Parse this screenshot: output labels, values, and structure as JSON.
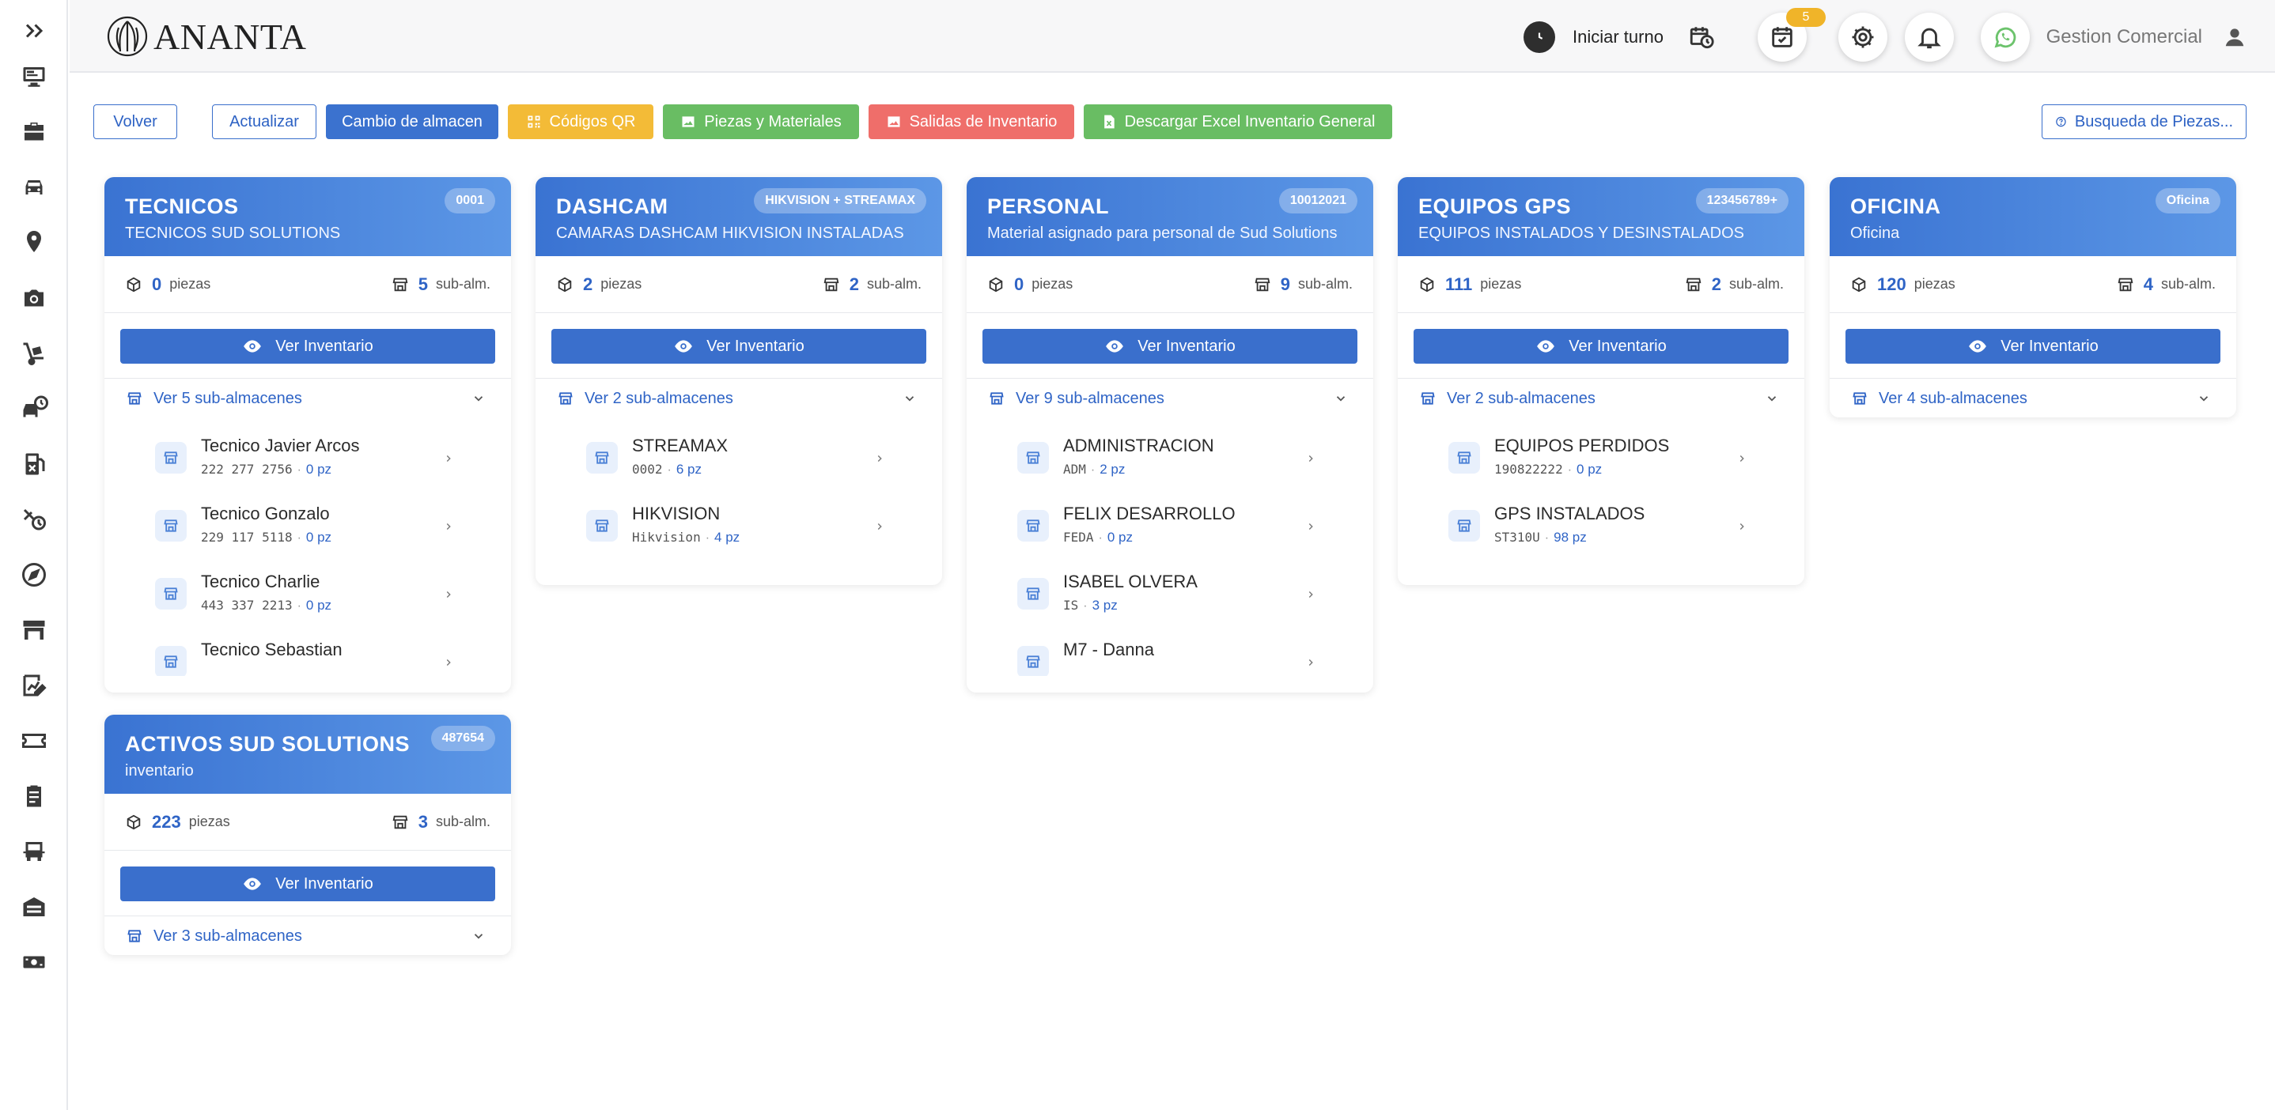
{
  "brand": {
    "name": "ANANTA"
  },
  "header": {
    "turno_label": "Iniciar turno",
    "tasks_badge": "5",
    "user_name": "Gestion Comercial"
  },
  "toolbar": {
    "volver": "Volver",
    "actualizar": "Actualizar",
    "cambio": "Cambio de almacen",
    "qr": "Códigos QR",
    "piezas": "Piezas y Materiales",
    "salidas": "Salidas de Inventario",
    "excel": "Descargar Excel Inventario General",
    "busqueda": "Busqueda de Piezas..."
  },
  "labels": {
    "piezas": "piezas",
    "subalm": "sub-alm.",
    "ver_inventario": "Ver Inventario",
    "dot": "·"
  },
  "colors": {
    "primary": "#3a6fcc",
    "header_gradient_start": "#3a73d2",
    "header_gradient_end": "#5c97e6",
    "yellow": "#f3bb37",
    "green": "#69bd63",
    "red": "#ef6e6a"
  },
  "warehouses": [
    {
      "title": "TECNICOS",
      "subtitle": "TECNICOS SUD SOLUTIONS",
      "code": "0001",
      "piezas": "0",
      "subalm": "5",
      "toggle": "Ver 5 sub-almacenes",
      "subs": [
        {
          "name": "Tecnico Javier Arcos",
          "code": "222 277 2756",
          "pz": "0 pz"
        },
        {
          "name": "Tecnico Gonzalo",
          "code": "229 117 5118",
          "pz": "0 pz"
        },
        {
          "name": "Tecnico Charlie",
          "code": "443 337 2213",
          "pz": "0 pz"
        },
        {
          "name": "Tecnico Sebastian",
          "code": "",
          "pz": ""
        }
      ]
    },
    {
      "title": "DASHCAM",
      "subtitle": "CAMARAS DASHCAM HIKVISION INSTALADAS",
      "code": "HIKVISION + STREAMAX",
      "piezas": "2",
      "subalm": "2",
      "toggle": "Ver 2 sub-almacenes",
      "subs": [
        {
          "name": "STREAMAX",
          "code": "0002",
          "pz": "6 pz"
        },
        {
          "name": "HIKVISION",
          "code": "Hikvision",
          "pz": "4 pz"
        }
      ]
    },
    {
      "title": "PERSONAL",
      "subtitle": "Material asignado para personal de Sud Solutions",
      "code": "10012021",
      "piezas": "0",
      "subalm": "9",
      "toggle": "Ver 9 sub-almacenes",
      "subs": [
        {
          "name": "ADMINISTRACION",
          "code": "ADM",
          "pz": "2 pz"
        },
        {
          "name": "FELIX DESARROLLO",
          "code": "FEDA",
          "pz": "0 pz"
        },
        {
          "name": "ISABEL OLVERA",
          "code": "IS",
          "pz": "3 pz"
        },
        {
          "name": "M7 - Danna",
          "code": "",
          "pz": ""
        }
      ]
    },
    {
      "title": "EQUIPOS GPS",
      "subtitle": "EQUIPOS INSTALADOS Y DESINSTALADOS",
      "code": "123456789+",
      "piezas": "111",
      "subalm": "2",
      "toggle": "Ver 2 sub-almacenes",
      "subs": [
        {
          "name": "EQUIPOS PERDIDOS",
          "code": "190822222",
          "pz": "0 pz"
        },
        {
          "name": "GPS INSTALADOS",
          "code": "ST310U",
          "pz": "98 pz"
        }
      ]
    },
    {
      "title": "OFICINA",
      "subtitle": "Oficina",
      "code": "Oficina",
      "piezas": "120",
      "subalm": "4",
      "toggle": "Ver 4 sub-almacenes",
      "subs": []
    },
    {
      "title": "ACTIVOS SUD SOLUTIONS",
      "subtitle": "inventario",
      "code": "487654",
      "piezas": "223",
      "subalm": "3",
      "toggle": "Ver 3 sub-almacenes",
      "subs": []
    }
  ]
}
